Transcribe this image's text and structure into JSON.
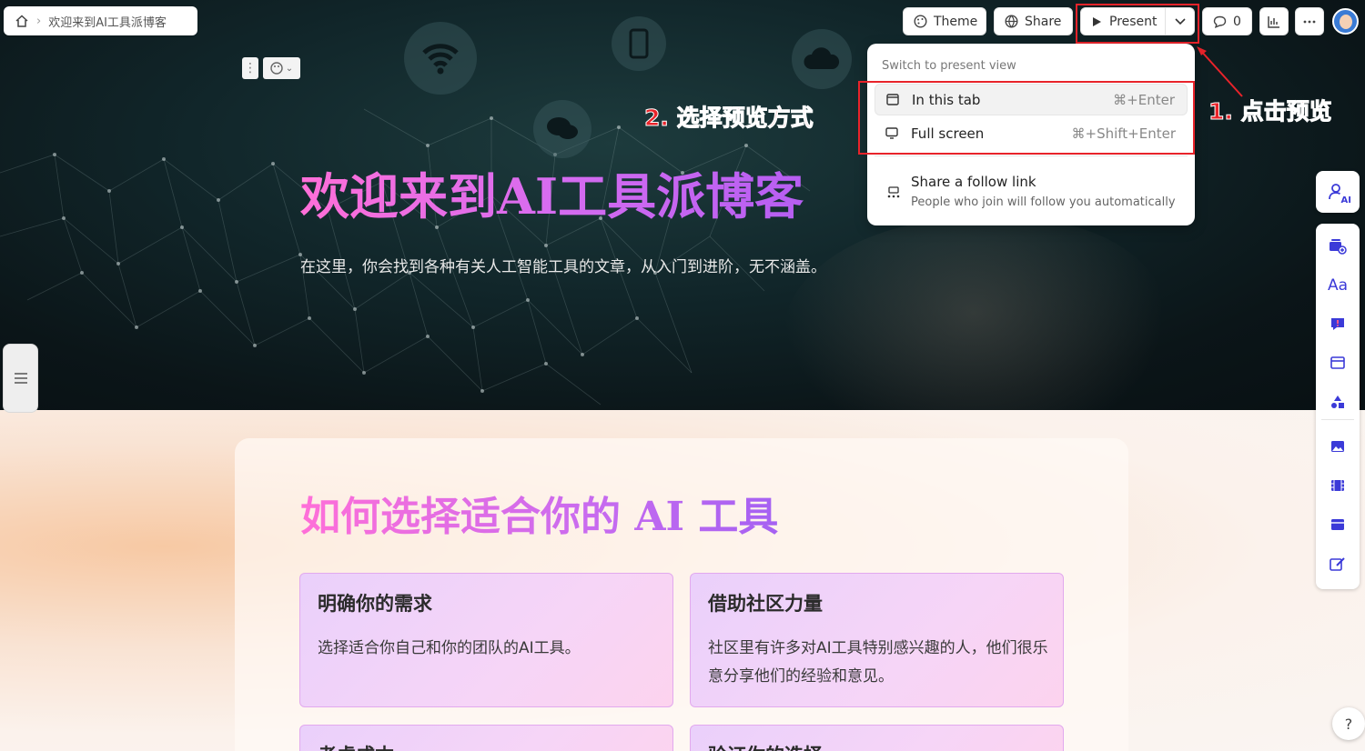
{
  "breadcrumb": {
    "page_title": "欢迎来到AI工具派博客"
  },
  "toolbar": {
    "theme_label": "Theme",
    "share_label": "Share",
    "present_label": "Present",
    "comment_count": "0"
  },
  "present_menu": {
    "header": "Switch to present view",
    "items": [
      {
        "label": "In this tab",
        "shortcut": "⌘+Enter",
        "icon": "window-icon"
      },
      {
        "label": "Full screen",
        "shortcut": "⌘+Shift+Enter",
        "icon": "monitor-icon"
      }
    ],
    "share": {
      "title": "Share a follow link",
      "description": "People who join will follow you automatically",
      "icon": "follow-link-icon"
    }
  },
  "annotations": {
    "step1": "1. 点击预览",
    "step2": "2. 选择预览方式"
  },
  "hero": {
    "title": "欢迎来到AI工具派博客",
    "subtitle": "在这里，你会找到各种有关人工智能工具的文章，从入门到进阶，无不涵盖。"
  },
  "section": {
    "title": "如何选择适合你的 AI 工具",
    "cards": [
      {
        "title": "明确你的需求",
        "body": "选择适合你自己和你的团队的AI工具。"
      },
      {
        "title": "借助社区力量",
        "body": "社区里有许多对AI工具特别感兴趣的人，他们很乐意分享他们的经验和意见。"
      },
      {
        "title": "考虑成本",
        "body": ""
      },
      {
        "title": "验证你的选择",
        "body": ""
      }
    ]
  },
  "right_toolbar": {
    "ai_label": "AI",
    "icons": [
      "add-card-icon",
      "text-style-icon",
      "callout-icon",
      "layout-icon",
      "shapes-icon",
      "image-icon",
      "video-icon",
      "embed-icon",
      "edit-form-icon"
    ]
  },
  "help": {
    "label": "?"
  },
  "colors": {
    "accent_red": "#e8232a",
    "title_gradient_start": "#ff6fd8",
    "title_gradient_end": "#b65ef2",
    "card_fill": "#f3d3f9"
  }
}
